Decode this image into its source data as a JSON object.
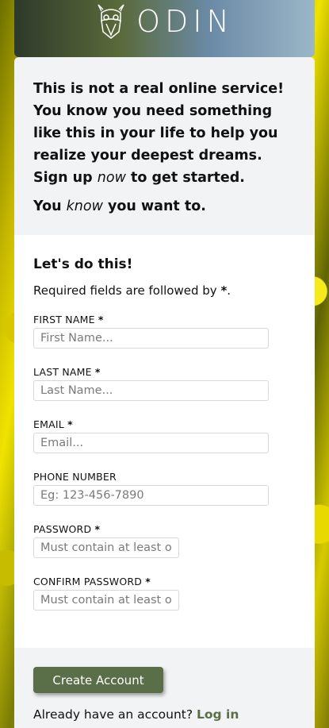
{
  "brand": {
    "name": "ODIN"
  },
  "intro": {
    "line1_pre": "This is not a real online service! You know you need something like this in your life to help you realize your deepest dreams. Sign up ",
    "line1_em": "now",
    "line1_post": " to get started.",
    "line2_pre": "You ",
    "line2_em": "know",
    "line2_post": " you want to."
  },
  "form": {
    "title": "Let's do this!",
    "required_note": "Required fields are followed by ",
    "required_star": "*",
    "required_note_end": ".",
    "fields": [
      {
        "label": "FIRST NAME",
        "required": "*",
        "placeholder": "First Name..."
      },
      {
        "label": "LAST NAME",
        "required": "*",
        "placeholder": "Last Name..."
      },
      {
        "label": "EMAIL",
        "required": "*",
        "placeholder": "Email..."
      },
      {
        "label": "PHONE NUMBER",
        "required": "",
        "placeholder": "Eg: 123-456-7890"
      },
      {
        "label": "PASSWORD",
        "required": "*",
        "placeholder": "Must contain at least one number and one uppercase and lowercase letter"
      },
      {
        "label": "CONFIRM PASSWORD",
        "required": "*",
        "placeholder": "Must contain at least one number and one uppercase and lowercase letter"
      }
    ]
  },
  "footer": {
    "submit_label": "Create Account",
    "login_prompt": "Already have an account? ",
    "login_link": "Log in"
  },
  "colors": {
    "accent": "#5a6e48",
    "panel_bg": "#f2f3f5"
  }
}
